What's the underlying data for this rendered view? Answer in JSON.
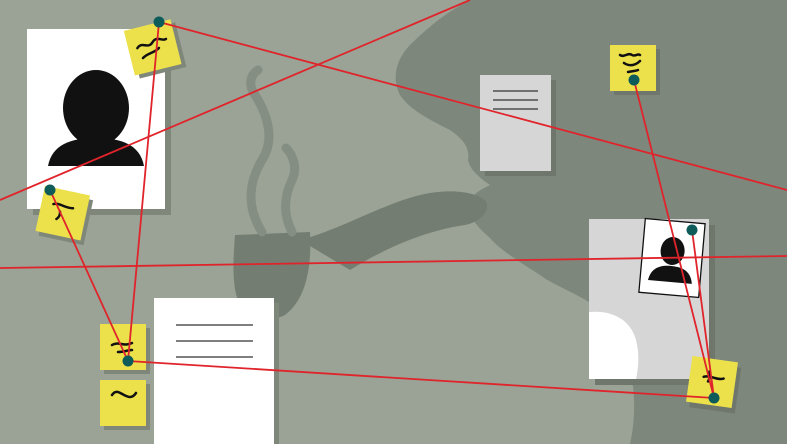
{
  "scene": {
    "description_hidden": "",
    "colors": {
      "background": "#9aa395",
      "silhouette": "#7e877c",
      "pipe_shadow": "#747d71",
      "paper_white": "#ffffff",
      "paper_grey": "#d6d6d6",
      "sticky": "#ece14a",
      "sticky_edge": "#d8cc36",
      "pin": "#0e5c5a",
      "string": "#e0242b",
      "shadow": "#7f877b",
      "ink": "#111111"
    },
    "icons": {
      "portrait_large": "person-silhouette-icon",
      "portrait_small": "person-silhouette-icon",
      "pushpin": "pushpin-icon",
      "scribble": "scribble-icon"
    }
  }
}
